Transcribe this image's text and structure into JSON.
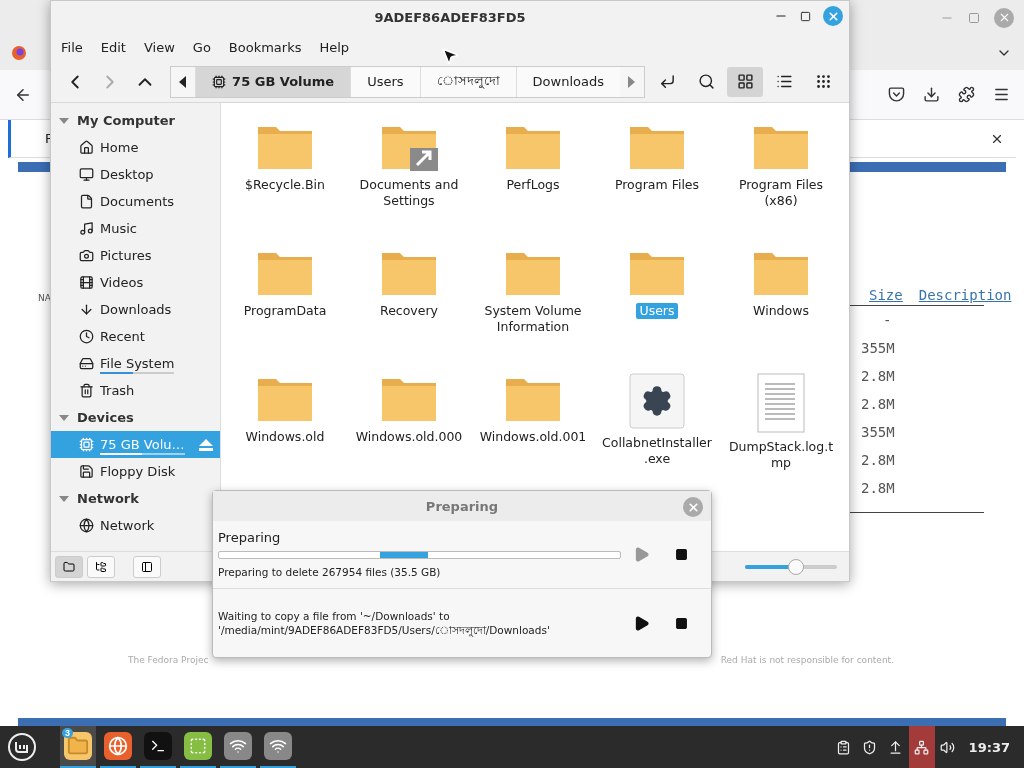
{
  "browser": {
    "notification_initial": "F",
    "side_text": "NA",
    "columns": [
      "Size",
      "Description"
    ],
    "sizes": [
      "-",
      "355M",
      "2.8M",
      "2.8M",
      "355M",
      "2.8M",
      "2.8M"
    ],
    "footer_left": "The Fedora Projec",
    "footer_right": "Red Hat is not responsible for content."
  },
  "file_manager": {
    "title": "9ADEF86ADEF83FD5",
    "menu": [
      "File",
      "Edit",
      "View",
      "Go",
      "Bookmarks",
      "Help"
    ],
    "path": [
      {
        "label": "75 GB Volume",
        "kind": "drive",
        "selected": true
      },
      {
        "label": "Users",
        "kind": "folder",
        "selected": false
      },
      {
        "label": "োসদলুদো",
        "kind": "folder",
        "selected": false
      },
      {
        "label": "Downloads",
        "kind": "folder",
        "selected": false
      }
    ],
    "views": [
      {
        "kind": "grid",
        "selected": true
      },
      {
        "kind": "list",
        "selected": false
      },
      {
        "kind": "compact",
        "selected": false
      }
    ],
    "sidebar": [
      {
        "title": "My Computer",
        "expanded": true,
        "items": [
          {
            "label": "Home",
            "kind": "home",
            "selected": false
          },
          {
            "label": "Desktop",
            "kind": "desktop",
            "selected": false
          },
          {
            "label": "Documents",
            "kind": "documents",
            "selected": false
          },
          {
            "label": "Music",
            "kind": "music",
            "selected": false
          },
          {
            "label": "Pictures",
            "kind": "pictures",
            "selected": false
          },
          {
            "label": "Videos",
            "kind": "videos",
            "selected": false
          },
          {
            "label": "Downloads",
            "kind": "downloads",
            "selected": false
          },
          {
            "label": "Recent",
            "kind": "recent",
            "selected": false
          },
          {
            "label": "File System",
            "kind": "filesystem",
            "selected": false,
            "level": 0.45
          },
          {
            "label": "Trash",
            "kind": "trash",
            "selected": false
          }
        ]
      },
      {
        "title": "Devices",
        "expanded": true,
        "items": [
          {
            "label": "75 GB Volu…",
            "kind": "drive",
            "selected": true,
            "level": 0.5,
            "ejectable": true
          },
          {
            "label": "Floppy Disk",
            "kind": "floppy",
            "selected": false
          }
        ]
      },
      {
        "title": "Network",
        "expanded": true,
        "items": [
          {
            "label": "Network",
            "kind": "network",
            "selected": false
          }
        ]
      }
    ],
    "files": [
      {
        "name": "$Recycle.Bin",
        "kind": "folder",
        "selected": false
      },
      {
        "name": "Documents and Settings",
        "kind": "link",
        "selected": false
      },
      {
        "name": "PerfLogs",
        "kind": "folder",
        "selected": false
      },
      {
        "name": "Program Files",
        "kind": "folder",
        "selected": false
      },
      {
        "name": "Program Files (x86)",
        "kind": "folder",
        "selected": false
      },
      {
        "name": "ProgramData",
        "kind": "folder",
        "selected": false
      },
      {
        "name": "Recovery",
        "kind": "folder",
        "selected": false
      },
      {
        "name": "System Volume Information",
        "kind": "folder",
        "selected": false
      },
      {
        "name": "Users",
        "kind": "folder",
        "selected": true
      },
      {
        "name": "Windows",
        "kind": "folder",
        "selected": false
      },
      {
        "name": "Windows.old",
        "kind": "folder",
        "selected": false
      },
      {
        "name": "Windows.old.000",
        "kind": "folder",
        "selected": false
      },
      {
        "name": "Windows.old.001",
        "kind": "folder",
        "selected": false
      },
      {
        "name": "CollabnetInstaller.exe",
        "kind": "exe",
        "selected": false
      },
      {
        "name": "DumpStack.log.tmp",
        "kind": "file",
        "selected": false
      }
    ],
    "sidebar_modes": [
      {
        "kind": "places",
        "selected": true
      },
      {
        "kind": "tree",
        "selected": false
      }
    ],
    "zoom": {
      "level": 0.55
    }
  },
  "dialog": {
    "title": "Preparing",
    "jobs": [
      {
        "heading": "Preparing",
        "indeterminate": true,
        "status": "Preparing to delete 267954 files (35.5 GB)",
        "paused": true
      },
      {
        "status": "Waiting to copy a file from '~/Downloads' to '/media/mint/9ADEF86ADEF83FD5/Users/োসদলুদো/Downloads'",
        "paused": false
      }
    ]
  },
  "taskbar": {
    "apps": [
      {
        "kind": "files",
        "selected": true,
        "badge": "3"
      },
      {
        "kind": "firefox",
        "selected": false
      },
      {
        "kind": "terminal",
        "selected": false
      },
      {
        "kind": "mint",
        "selected": false
      },
      {
        "kind": "wifi",
        "selected": false
      },
      {
        "kind": "wifi",
        "selected": false
      }
    ],
    "tray": [
      {
        "kind": "clipboard",
        "alert": false
      },
      {
        "kind": "shield",
        "alert": false
      },
      {
        "kind": "updates",
        "alert": false
      },
      {
        "kind": "network",
        "alert": true
      },
      {
        "kind": "volume",
        "alert": false
      }
    ],
    "clock": "19:37"
  }
}
